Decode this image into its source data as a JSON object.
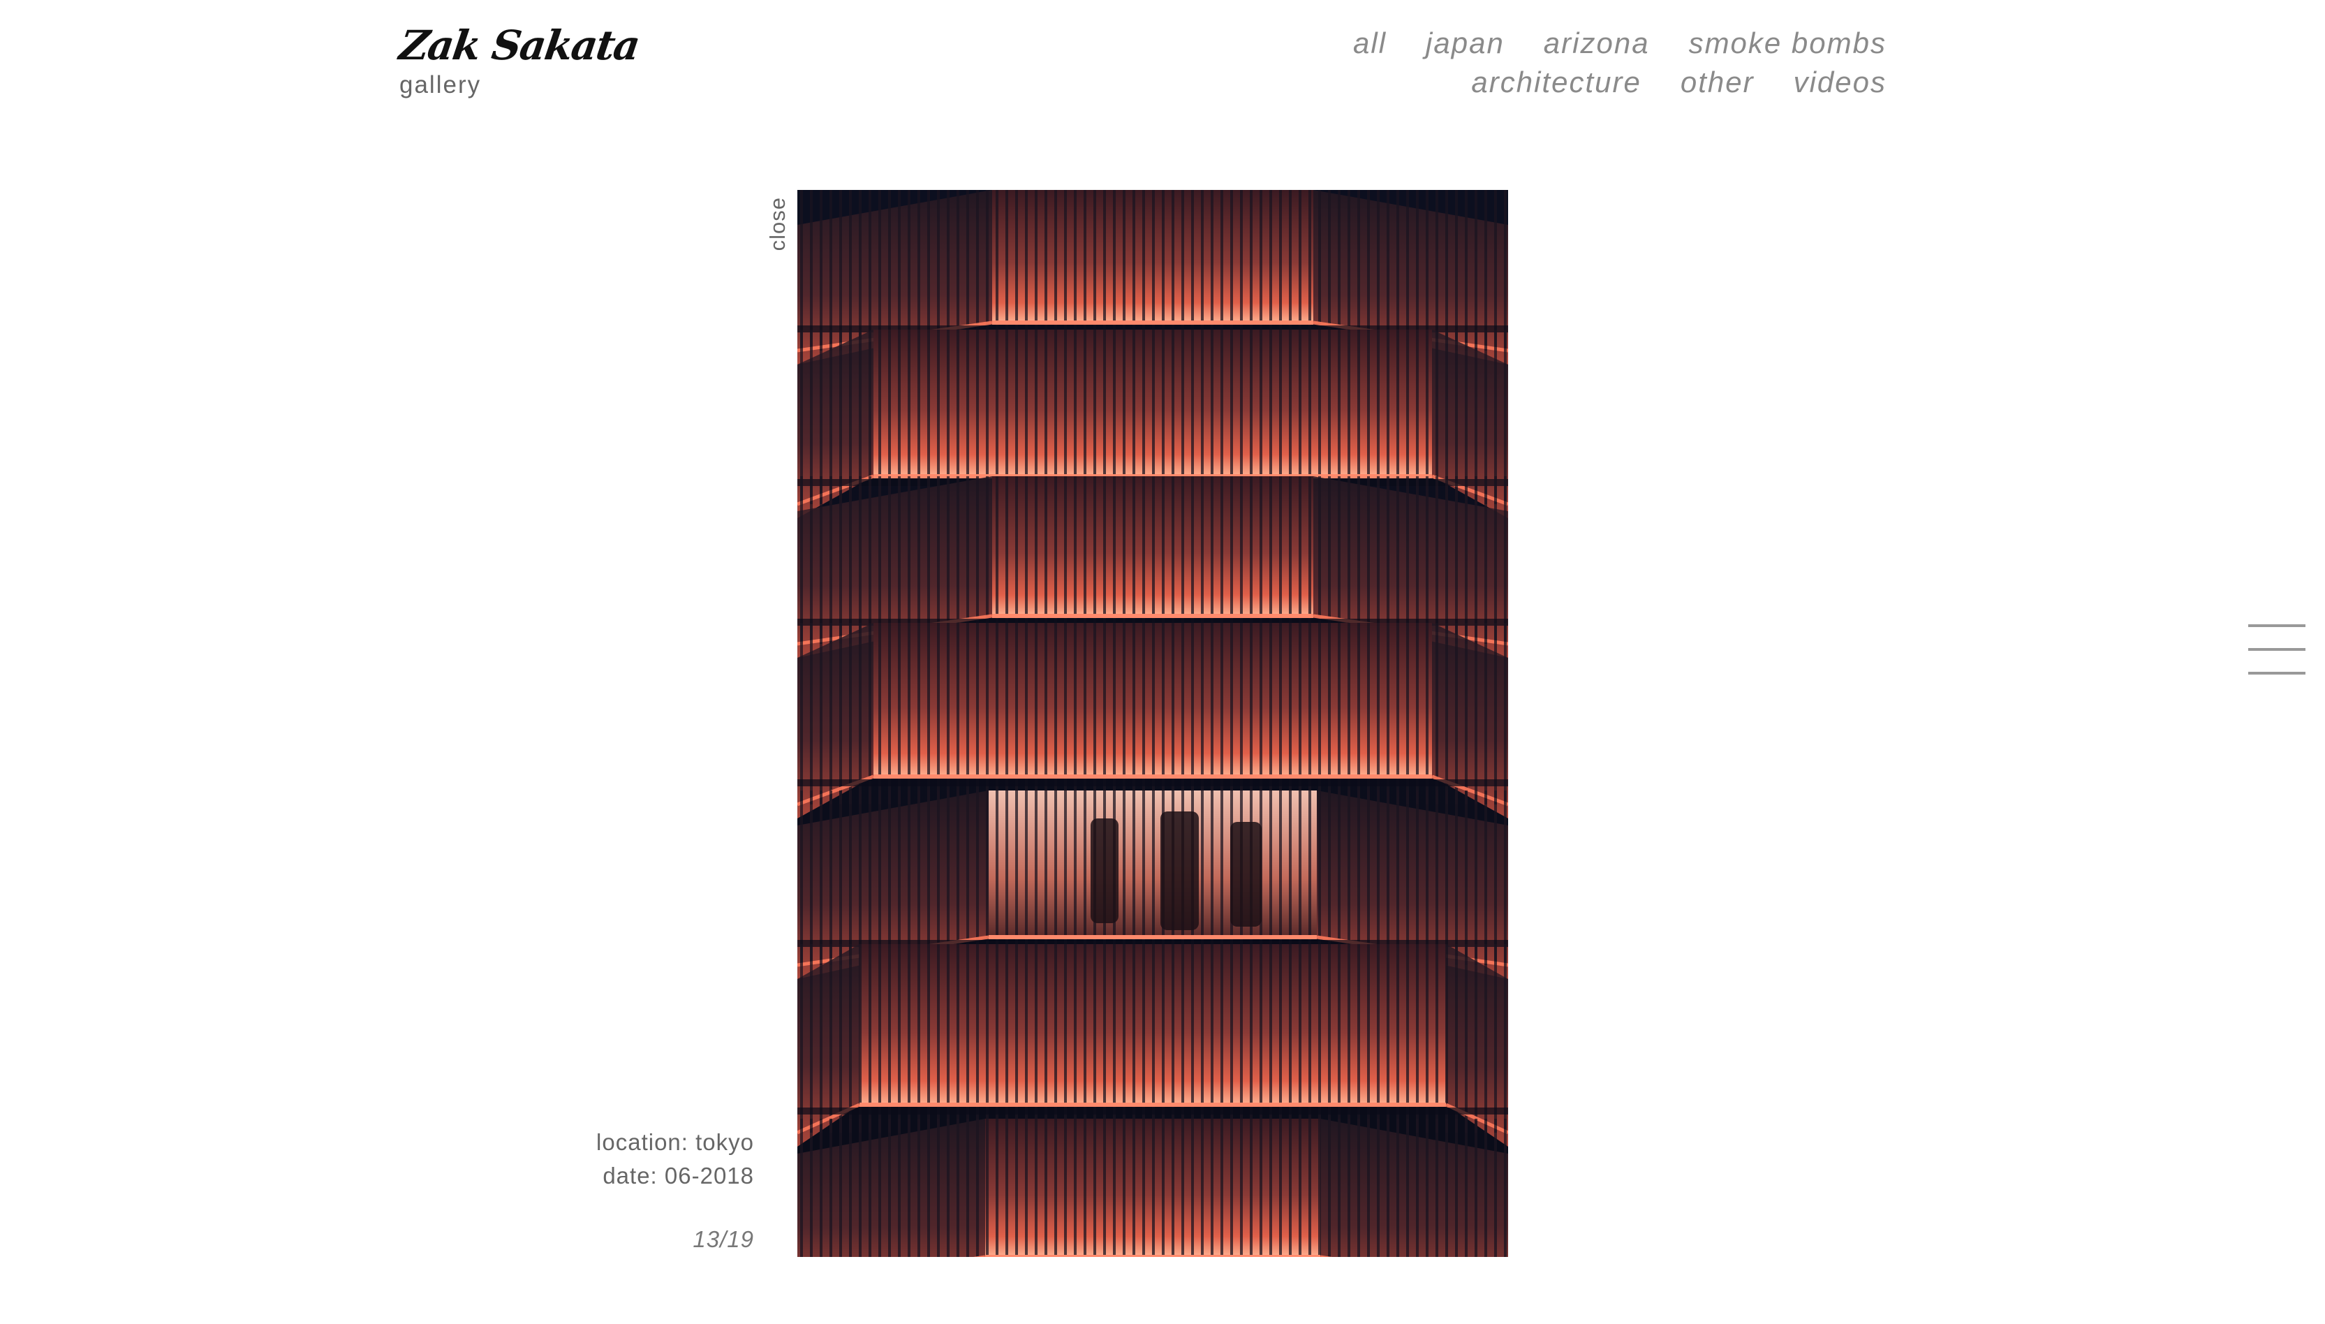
{
  "brand": {
    "name": "Zak Sakata",
    "subtitle": "gallery"
  },
  "nav": {
    "row1": [
      "all",
      "japan",
      "arizona",
      "smoke bombs"
    ],
    "row2": [
      "architecture",
      "other",
      "videos"
    ]
  },
  "viewer": {
    "close_label": "close",
    "location": "location: tokyo",
    "date": "date: 06-2018",
    "counter": "13/19",
    "photo_alt": "tokyo building facade at night"
  },
  "icons": {
    "menu": "hamburger-menu-icon"
  },
  "colors": {
    "accent_glow": "#e0604a",
    "photo_background": "#0b0d1c",
    "nav_text": "#8a8a8a"
  }
}
